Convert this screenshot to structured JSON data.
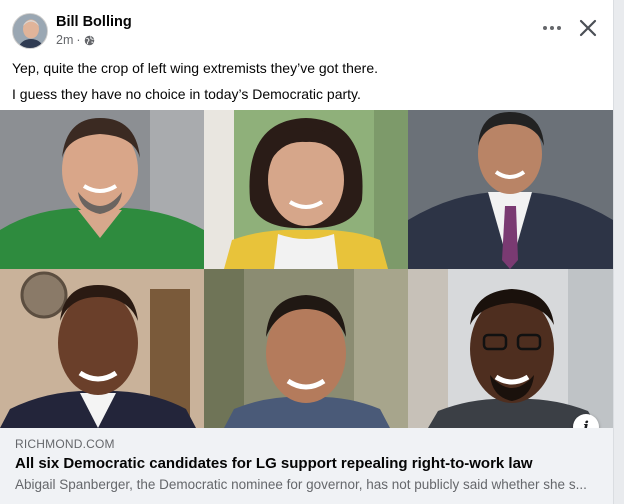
{
  "post": {
    "author": "Bill Bolling",
    "timestamp": "2m",
    "separator": "·",
    "audience_icon": "globe-icon",
    "text_lines": [
      "Yep, quite the crop of left wing extremists they’ve got there.",
      "I guess they have no choice in today’s Democratic party."
    ],
    "more_icon": "more-horizontal-icon",
    "close_icon": "close-icon"
  },
  "link_preview": {
    "domain": "RICHMOND.COM",
    "title": "All six Democratic candidates for LG support repealing right-to-work law",
    "description": "Abigail Spanberger, the Democratic nominee for governor, has not publicly said whether she s...",
    "info_icon": "i"
  },
  "colors": {
    "card_bg": "#ffffff",
    "preview_bg": "#f0f2f5",
    "secondary_text": "#65676b",
    "primary_text": "#050505"
  }
}
